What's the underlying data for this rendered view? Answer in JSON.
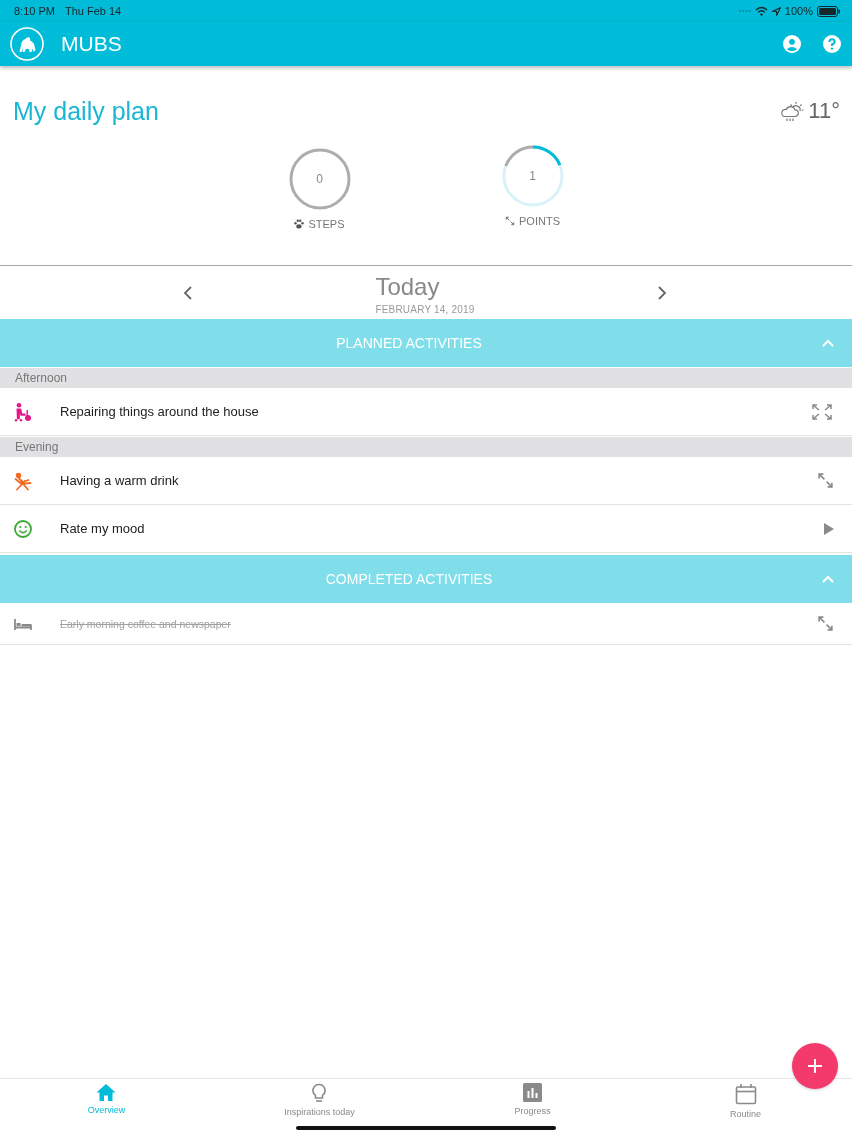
{
  "status_bar": {
    "time": "8:10 PM",
    "date": "Thu Feb 14",
    "battery": "100%"
  },
  "app_bar": {
    "title": "MUBS"
  },
  "header": {
    "title": "My daily plan",
    "temperature": "11°"
  },
  "rings": [
    {
      "kind": "steps",
      "value": "0",
      "label": "STEPS"
    },
    {
      "kind": "points",
      "value": "1",
      "label": "POINTS"
    }
  ],
  "date_nav": {
    "day": "Today",
    "date": "FEBRUARY 14, 2019"
  },
  "sections": [
    {
      "title": "PLANNED ACTIVITIES",
      "expanded": true,
      "groups": [
        {
          "label": "Afternoon",
          "items": [
            {
              "kind": "chores",
              "label": "Repairing things around the house",
              "color": "#e3168c",
              "done": false
            }
          ]
        },
        {
          "label": "Evening",
          "items": [
            {
              "kind": "relaxing",
              "label": "Having a warm drink",
              "color": "#f26b21",
              "done": false
            },
            {
              "kind": "mood",
              "label": "Rate my mood",
              "color": "#3aaa35",
              "done": false
            }
          ]
        }
      ]
    },
    {
      "title": "COMPLETED ACTIVITIES",
      "expanded": true,
      "groups": [
        {
          "items": [
            {
              "kind": "sleep",
              "label": "Early morning coffee and newspaper",
              "color": "#8a8a8a",
              "done": true
            }
          ]
        }
      ]
    }
  ],
  "bottom_nav": {
    "tabs": [
      {
        "kind": "overview",
        "label": "Overview",
        "selected": true
      },
      {
        "kind": "inspirations",
        "label": "Inspirations today",
        "selected": false
      },
      {
        "kind": "progress",
        "label": "Progress",
        "selected": false
      },
      {
        "kind": "routine",
        "label": "Routine",
        "selected": false
      }
    ]
  }
}
